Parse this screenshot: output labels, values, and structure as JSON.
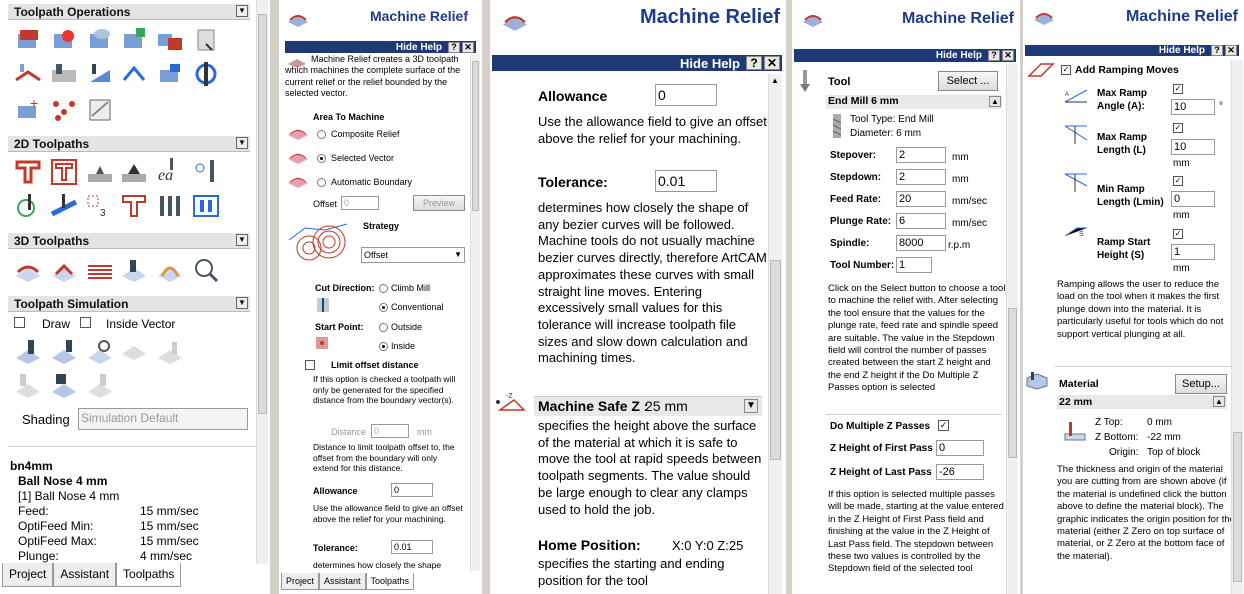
{
  "p1": {
    "sections": {
      "ops": "Toolpath Operations",
      "toolpaths2d": "2D Toolpaths",
      "toolpaths3d": "3D Toolpaths",
      "sim": "Toolpath Simulation"
    },
    "draw_label": "Draw",
    "inside_vector_label": "Inside Vector",
    "shading_label": "Shading",
    "shading_value": "Simulation Default",
    "tool_name": "bn4mm",
    "tool_title": "Ball Nose 4 mm",
    "tool_sub": "[1] Ball Nose 4 mm",
    "props": [
      {
        "k": "Feed:",
        "v": "15 mm/sec"
      },
      {
        "k": "OptiFeed Min:",
        "v": "15 mm/sec"
      },
      {
        "k": "OptiFeed Max:",
        "v": "15 mm/sec"
      },
      {
        "k": "Plunge:",
        "v": "4 mm/sec"
      }
    ],
    "tabs": [
      "Project",
      "Assistant",
      "Toolpaths"
    ]
  },
  "p2": {
    "title": "Machine Relief",
    "hide_help": "Hide Help",
    "help_text": "Machine Relief creates a 3D toolpath which machines the complete surface of the current relief or the relief bounded by the selected vector.",
    "area_label": "Area To Machine",
    "area_options": [
      "Composite Relief",
      "Selected Vector",
      "Automatic Boundary"
    ],
    "offset_label": "Offset",
    "offset_value": "0",
    "preview_label": "Preview",
    "strategy_label": "Strategy",
    "strategy_value": "Offset",
    "cut_direction_label": "Cut Direction:",
    "climb_label": "Climb Mill",
    "conventional_label": "Conventional",
    "start_point_label": "Start Point:",
    "outside_label": "Outside",
    "inside_label": "Inside",
    "limit_label": "Limit offset distance",
    "limit_help": "If this option is checked a toolpath will only be generated for the specified distance from the boundary vector(s).",
    "distance_label": "Distance",
    "distance_value": "0",
    "distance_unit": "mm",
    "distance_help": "Distance to limit toolpath offset to, the offset from the boundary will only extend for this distance.",
    "allowance_label": "Allowance",
    "allowance_value": "0",
    "allowance_help": "Use the allowance field to give an offset above the relief for your machining.",
    "tolerance_label": "Tolerance:",
    "tolerance_value": "0.01",
    "tolerance_help_start": "determines how closely the shape",
    "tabs": [
      "Project",
      "Assistant",
      "Toolpaths"
    ]
  },
  "p3": {
    "title": "Machine Relief",
    "hide_help": "Hide Help",
    "allowance_label": "Allowance",
    "allowance_value": "0",
    "allowance_help": "Use the allowance field to give an offset above the relief for your machining.",
    "tolerance_label": "Tolerance:",
    "tolerance_value": "0.01",
    "tolerance_help": "determines how closely the shape of any bezier curves will be followed. Machine tools do not usually machine bezier curves directly, therefore ArtCAM approximates these curves with small straight line moves. Entering excessively small values for this tolerance will increase toolpath file sizes and slow down calculation and machining times.",
    "safe_z_label": "Machine Safe Z :",
    "safe_z_value": "25 mm",
    "safe_z_help": "specifies the height above the surface of the material at which it is safe to move the tool at rapid speeds between toolpath segments. The value should be large enough to clear any clamps used to hold the job.",
    "home_label": "Home Position:",
    "home_value": "X:0 Y:0 Z:25",
    "home_help": "specifies the starting and ending position for the tool"
  },
  "p4": {
    "title": "Machine Relief",
    "hide_help": "Hide Help",
    "tool_label": "Tool",
    "select_label": "Select ...",
    "tool_name": "End Mill 6 mm",
    "tool_type": "Tool Type: End Mill",
    "diameter": "Diameter: 6 mm",
    "fields": [
      {
        "label": "Stepover:",
        "value": "2",
        "unit": "mm"
      },
      {
        "label": "Stepdown:",
        "value": "2",
        "unit": "mm"
      },
      {
        "label": "Feed Rate:",
        "value": "20",
        "unit": "mm/sec"
      },
      {
        "label": "Plunge Rate:",
        "value": "6",
        "unit": "mm/sec"
      },
      {
        "label": "Spindle:",
        "value": "8000",
        "unit": "r.p.m"
      }
    ],
    "tool_number_label": "Tool Number:",
    "tool_number_value": "1",
    "help1": "Click on the Select button to choose a tool to machine the relief with. After selecting the tool ensure that the values for the plunge rate, feed rate and spindle speed are suitable. The value in the Stepdown field will control the number of passes created between the start Z height and the end Z height if the Do Multiple Z Passes option is selected",
    "multi_label": "Do Multiple Z Passes",
    "first_label": "Z Height of First Pass",
    "first_value": "0",
    "last_label": "Z Height of Last Pass",
    "last_value": "-26",
    "help2": "If this option is selected multiple passes will be made, starting at the value entered in the Z Height of First Pass field and finishing at the value in the Z Height of Last Pass field. The stepdown between these two values is controlled by the Stepdown field of the selected tool"
  },
  "p5": {
    "title": "Machine Relief",
    "hide_help": "Hide Help",
    "ramping_label": "Add Ramping Moves",
    "ramp_fields": [
      {
        "label": "Max Ramp Angle  (A):",
        "value": "10",
        "unit": "°"
      },
      {
        "label": "Max Ramp Length (L)",
        "value": "10",
        "unit": "mm"
      },
      {
        "label": "Min Ramp Length (Lmin)",
        "value": "0",
        "unit": "mm"
      },
      {
        "label": "Ramp Start Height (S)",
        "value": "1",
        "unit": "mm"
      }
    ],
    "ramp_help": "Ramping allows the user to reduce the load on the tool when it makes the first plunge down into the material. It is particularly useful for tools which do not support vertical plunging at all.",
    "material_label": "Material",
    "setup_label": "Setup...",
    "material_value": "22 mm",
    "ztop_label": "Z Top:",
    "ztop_value": "0 mm",
    "zbottom_label": "Z Bottom:",
    "zbottom_value": "-22 mm",
    "origin_label": "Origin:",
    "origin_value": "Top of block",
    "material_help": "The thickness and origin of the material you are cutting from are shown above (if the material is undefined click the button above to define the material block). The graphic indicates the origin position for the material (either Z Zero on top surface of material, or Z Zero at the bottom face of the material)."
  }
}
